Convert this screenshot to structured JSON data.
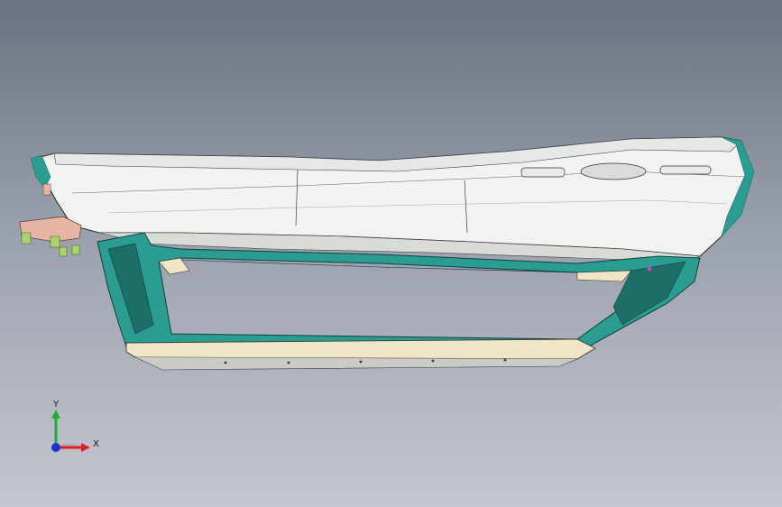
{
  "viewport": {
    "background_top": "#6a7180",
    "background_bottom": "#c4c7cf"
  },
  "model": {
    "icon": "door-trim-panel-3d-model",
    "colors": {
      "trim_panel": "#f2f3f1",
      "frame": "#2a9c92",
      "frame_dark": "#1e6e68",
      "rail": "#efe6c8",
      "clip": "#e6b5a6"
    }
  },
  "triad": {
    "x_label": "X",
    "y_label": "Y",
    "x_color": "#e02020",
    "y_color": "#20b030",
    "z_color": "#2030d0"
  }
}
